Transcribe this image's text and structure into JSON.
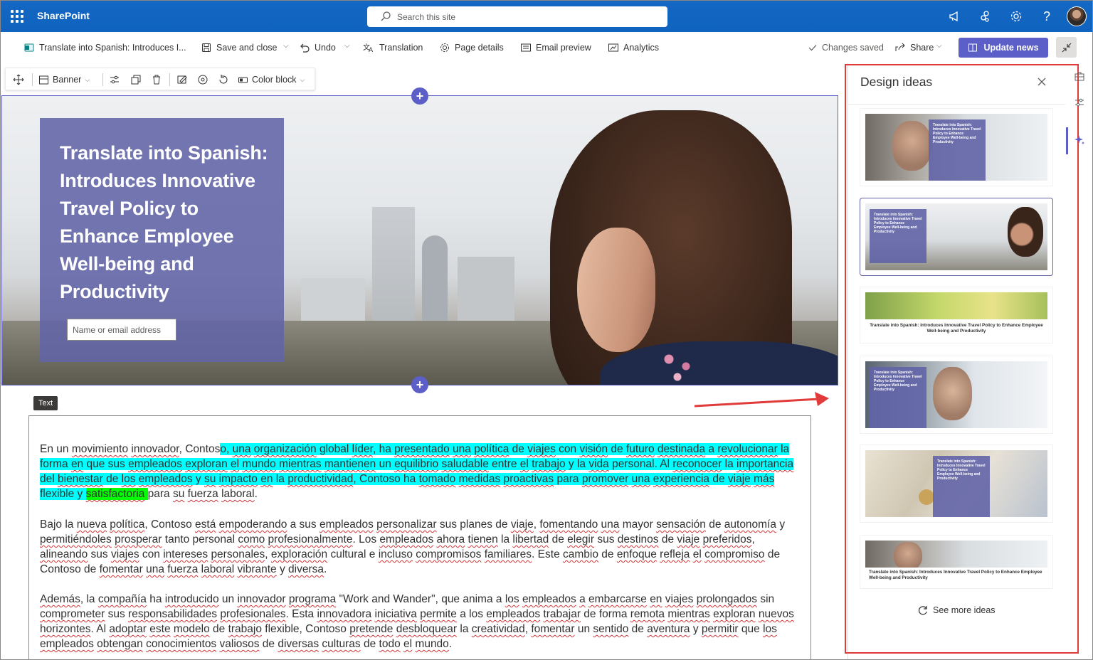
{
  "suite": {
    "app_name": "SharePoint",
    "search_placeholder": "Search this site"
  },
  "command_bar": {
    "page_name": "Translate into Spanish: Introduces I...",
    "save_close": "Save and close",
    "undo": "Undo",
    "translation": "Translation",
    "page_details": "Page details",
    "email_preview": "Email preview",
    "analytics": "Analytics",
    "status": "Changes saved",
    "share": "Share",
    "update": "Update news"
  },
  "section_toolbar": {
    "layout": "Banner",
    "background": "Color block"
  },
  "hero": {
    "title": "Translate into Spanish: Introduces Innovative Travel Policy to Enhance Employee Well-being and Productivity",
    "author_placeholder": "Name or email address"
  },
  "text_webpart": {
    "tag": "Text",
    "paragraphs": [
      "En un movimiento innovador, Contoso, una organización global líder, ha presentado una política de viajes con visión de futuro destinada a revolucionar la forma en que sus empleados exploran el mundo mientras mantienen un equilibrio saludable entre el trabajo y la vida personal. Al reconocer la importancia del bienestar de los empleados y su impacto en la productividad, Contoso ha tomado medidas proactivas para promover una experiencia de viaje más flexible y satisfactoria para su fuerza laboral.",
      "Bajo la nueva política, Contoso está empoderando a sus empleados personalizar sus planes de viaje, fomentando una mayor sensación de autonomía y permitiéndoles prosperar tanto personal como profesionalmente. Los empleados ahora tienen la libertad de elegir sus destinos de viaje preferidos, alineando sus viajes con intereses personales, exploración cultural e incluso compromisos familiares. Este cambio de enfoque refleja el compromiso de Contoso de fomentar una fuerza laboral vibrante y diversa.",
      "Además, la compañía ha introducido un innovador programa \"Work and Wander\", que anima a los empleados a embarcarse en viajes prolongados sin comprometer sus responsabilidades profesionales. Esta innovadora iniciativa permite a los empleados trabajar de forma remota mientras exploran nuevos horizontes. Al adoptar este modelo de trabajo flexible, Contoso pretende desbloquear la creatividad, fomentar un sentido de aventura y permitir que los empleados obtengan conocimientos valiosos de diversas culturas de todo el mundo."
    ]
  },
  "design_panel": {
    "title": "Design ideas",
    "thumb_title_short": "Translate into Spanish: Introduces Innovative Travel Policy to Enhance Employee Well-being and Productivity",
    "see_more": "See more ideas"
  },
  "colors": {
    "suite_blue": "#0f64bf",
    "accent": "#5b5fc7",
    "title_block": "#6264a7",
    "highlight_cyan": "#00ffff",
    "highlight_green": "#00ff00",
    "callout_red": "#e03a3a"
  }
}
